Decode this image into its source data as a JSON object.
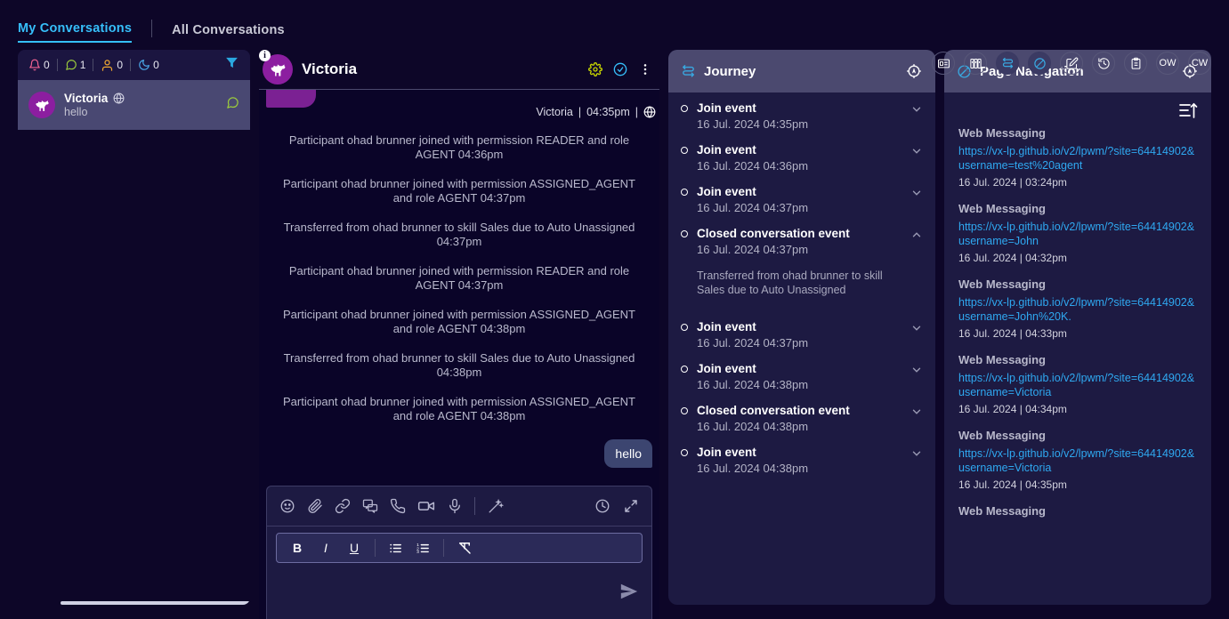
{
  "tabs": {
    "my_conversations": "My Conversations",
    "all_conversations": "All Conversations"
  },
  "conversation_list": {
    "stats": [
      {
        "icon": "bell-icon",
        "name": "alerts",
        "value": "0"
      },
      {
        "icon": "chat-bubble-icon",
        "name": "open-conversations",
        "value": "1"
      },
      {
        "icon": "user-icon",
        "name": "assigned",
        "value": "0"
      },
      {
        "icon": "moon-icon",
        "name": "snoozed",
        "value": "0"
      }
    ],
    "filter_label": "filter-icon",
    "items": [
      {
        "name": "Victoria",
        "preview": "hello",
        "channel_icon": "globe-icon",
        "status_icon": "chat-bubble-icon"
      }
    ]
  },
  "chat": {
    "title": "Victoria",
    "info_badge": "i",
    "header_actions": [
      {
        "name": "settings-gear-icon",
        "color": "#c6d400"
      },
      {
        "name": "check-circle-icon",
        "color": "#36bffa"
      },
      {
        "name": "more-vertical-icon",
        "color": "#ffffff"
      }
    ],
    "meta_author": "Victoria",
    "meta_time": "04:35pm",
    "meta_channel_icon": "globe-icon",
    "system_messages": [
      "Participant ohad brunner joined with permission READER and role AGENT 04:36pm",
      "Participant ohad brunner joined with permission ASSIGNED_AGENT and role AGENT 04:37pm",
      "Transferred from ohad brunner to skill Sales due to Auto Unassigned 04:37pm",
      "Participant ohad brunner joined with permission READER and role AGENT 04:37pm",
      "Participant ohad brunner joined with permission ASSIGNED_AGENT and role AGENT 04:38pm",
      "Transferred from ohad brunner to skill Sales due to Auto Unassigned 04:38pm",
      "Participant ohad brunner joined with permission ASSIGNED_AGENT and role AGENT 04:38pm"
    ],
    "outgoing_message": "hello"
  },
  "composer": {
    "tools": [
      "emoji-icon",
      "attachment-icon",
      "link-icon",
      "predefined-content-icon",
      "phone-icon",
      "video-icon",
      "microphone-icon"
    ],
    "ai_tool": "magic-wand-icon",
    "right_tools": [
      "history-clock-icon",
      "expand-icon"
    ],
    "format_buttons": [
      {
        "name": "bold-button",
        "label": "B"
      },
      {
        "name": "italic-button",
        "label": "I"
      },
      {
        "name": "underline-button",
        "label": "U"
      },
      {
        "name": "bulleted-list-button",
        "label": "bulleted-list-icon"
      },
      {
        "name": "numbered-list-button",
        "label": "numbered-list-icon"
      },
      {
        "name": "clear-formatting-button",
        "label": "clear-formatting-icon"
      }
    ],
    "editor_placeholder": "",
    "editor_value": "",
    "send_label": "send-icon"
  },
  "widget_toolbar": [
    {
      "name": "customer-info-icon",
      "selected": false
    },
    {
      "name": "knowledge-base-icon",
      "selected": false
    },
    {
      "name": "journey-icon",
      "selected": true
    },
    {
      "name": "page-navigation-icon",
      "selected": true
    },
    {
      "name": "notes-icon",
      "selected": false
    },
    {
      "name": "history-icon",
      "selected": false
    },
    {
      "name": "clipboard-icon",
      "selected": false
    },
    {
      "name": "avatar-ow",
      "label": "OW",
      "selected": false
    },
    {
      "name": "avatar-cw",
      "label": "CW",
      "selected": false
    }
  ],
  "journey": {
    "title": "Journey",
    "title_icon": "journey-icon",
    "locate_icon": "compass-icon",
    "events": [
      {
        "title": "Join event",
        "date": "16 Jul. 2024 04:35pm",
        "expanded": false,
        "detail": ""
      },
      {
        "title": "Join event",
        "date": "16 Jul. 2024 04:36pm",
        "expanded": false,
        "detail": ""
      },
      {
        "title": "Join event",
        "date": "16 Jul. 2024 04:37pm",
        "expanded": false,
        "detail": ""
      },
      {
        "title": "Closed conversation event",
        "date": "16 Jul. 2024 04:37pm",
        "expanded": true,
        "detail": "Transferred from ohad brunner to skill Sales due to Auto Unassigned"
      },
      {
        "title": "Join event",
        "date": "16 Jul. 2024 04:37pm",
        "expanded": false,
        "detail": ""
      },
      {
        "title": "Join event",
        "date": "16 Jul. 2024 04:38pm",
        "expanded": false,
        "detail": ""
      },
      {
        "title": "Closed conversation event",
        "date": "16 Jul. 2024 04:38pm",
        "expanded": false,
        "detail": ""
      },
      {
        "title": "Join event",
        "date": "16 Jul. 2024 04:38pm",
        "expanded": false,
        "detail": ""
      }
    ]
  },
  "page_navigation": {
    "title": "Page Navigation",
    "title_icon": "page-navigation-icon",
    "locate_icon": "compass-icon",
    "sort_icon": "sort-ascending-icon",
    "items": [
      {
        "kind": "Web Messaging",
        "url": "https://vx-lp.github.io/v2/lpwm/?site=64414902&username=test%20agent",
        "date": "16 Jul. 2024 | 03:24pm"
      },
      {
        "kind": "Web Messaging",
        "url": "https://vx-lp.github.io/v2/lpwm/?site=64414902&username=John",
        "date": "16 Jul. 2024 | 04:32pm"
      },
      {
        "kind": "Web Messaging",
        "url": "https://vx-lp.github.io/v2/lpwm/?site=64414902&username=John%20K.",
        "date": "16 Jul. 2024 | 04:33pm"
      },
      {
        "kind": "Web Messaging",
        "url": "https://vx-lp.github.io/v2/lpwm/?site=64414902&username=Victoria",
        "date": "16 Jul. 2024 | 04:34pm"
      },
      {
        "kind": "Web Messaging",
        "url": "https://vx-lp.github.io/v2/lpwm/?site=64414902&username=Victoria",
        "date": "16 Jul. 2024 | 04:35pm"
      },
      {
        "kind": "Web Messaging",
        "url": "",
        "date": ""
      }
    ]
  },
  "colors": {
    "background": "#0d0628",
    "accent": "#36bffa",
    "avatar": "#8c1ea0",
    "panel_header": "#4b496f",
    "link": "#2fa8f0"
  }
}
